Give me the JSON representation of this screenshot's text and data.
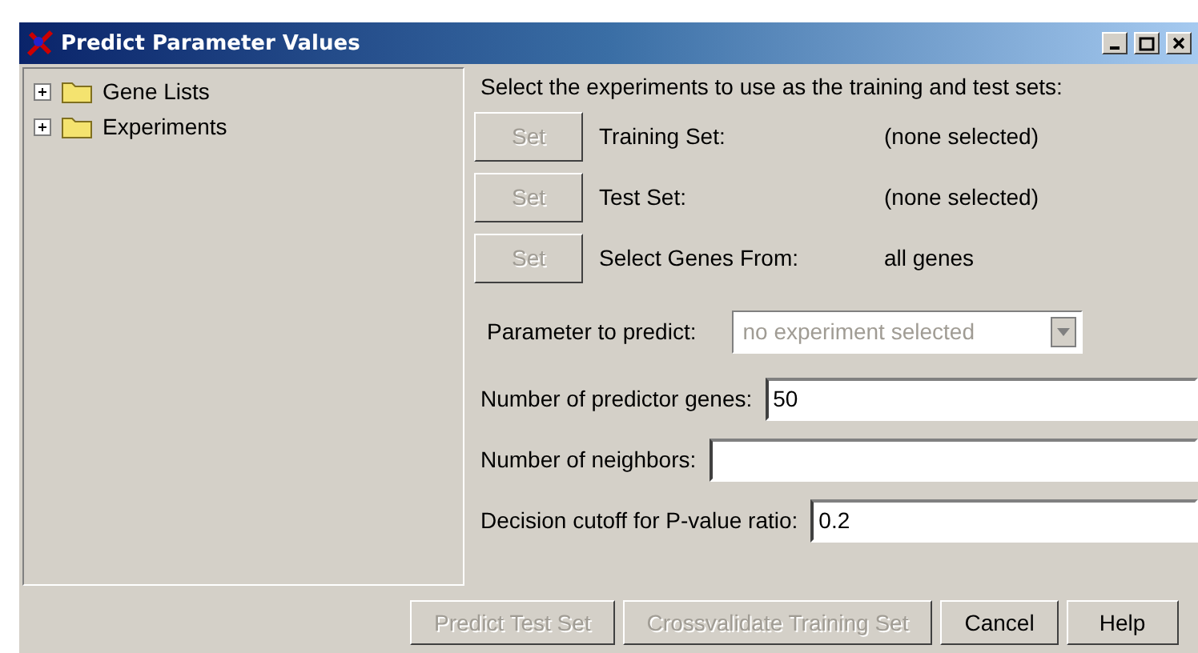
{
  "window": {
    "title": "Predict Parameter Values"
  },
  "tree": [
    {
      "label": "Gene Lists",
      "expanded": false
    },
    {
      "label": "Experiments",
      "expanded": false
    }
  ],
  "instructions": "Select the experiments to use as the training and test sets:",
  "set_rows": [
    {
      "button": "Set",
      "disabled": true,
      "label": "Training Set:",
      "value": "(none selected)"
    },
    {
      "button": "Set",
      "disabled": true,
      "label": "Test Set:",
      "value": "(none selected)"
    },
    {
      "button": "Set",
      "disabled": true,
      "label": "Select Genes From:",
      "value": "all genes"
    }
  ],
  "parameter": {
    "label": "Parameter to predict:",
    "value": "no experiment selected",
    "disabled": true
  },
  "fields": [
    {
      "label": "Number of predictor genes:",
      "value": "50"
    },
    {
      "label": "Number of neighbors:"
    },
    {
      "label": "Decision cutoff for P-value ratio:",
      "value": "0.2"
    }
  ],
  "buttons": [
    {
      "label": "Predict Test Set",
      "disabled": true
    },
    {
      "label": "Crossvalidate Training Set",
      "disabled": true
    },
    {
      "label": "Cancel",
      "disabled": false
    },
    {
      "label": "Help",
      "disabled": false
    }
  ]
}
